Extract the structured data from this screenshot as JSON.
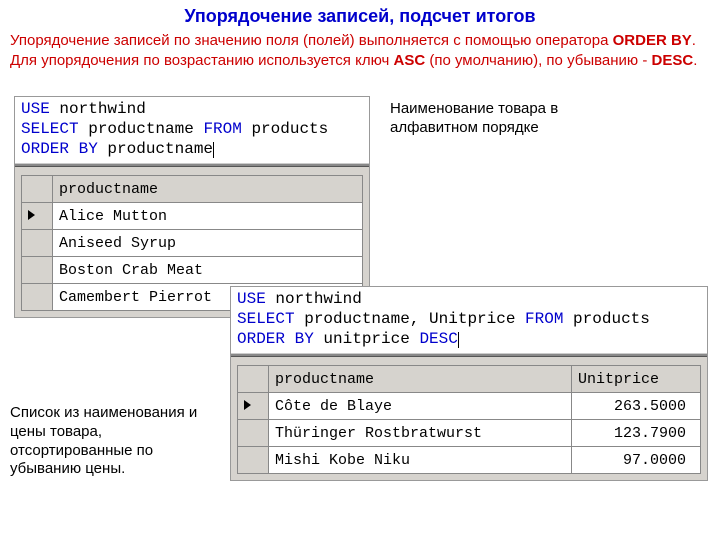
{
  "title": "Упорядочение записей, подсчет итогов",
  "intro_parts": {
    "p1": "Упорядочение записей по значению поля (полей) выполняется с помощью оператора ",
    "b1": "ORDER BY",
    "p2": ". Для упорядочения по возрастанию используется ключ ",
    "b2": "ASC",
    "p3": " (по умолчанию), по убыванию - ",
    "b3": "DESC",
    "p4": "."
  },
  "caption1": "Наименование товара в алфавитном порядке",
  "caption2": "Список из наименования и цены товара, отсортированные по убыванию цены.",
  "query1": {
    "kw_use": "USE",
    "use_val": " northwind",
    "kw_select": "SELECT",
    "sel_val": " productname ",
    "kw_from": "FROM",
    "from_val": " products",
    "kw_order": "ORDER BY",
    "order_val": " productname"
  },
  "query2": {
    "kw_use": "USE",
    "use_val": " northwind",
    "kw_select": "SELECT",
    "sel_val": " productname, Unitprice ",
    "kw_from": "FROM",
    "from_val": " products",
    "kw_order": "ORDER BY",
    "order_val": " unitprice ",
    "kw_desc": "DESC"
  },
  "table1": {
    "header": "productname",
    "rows": [
      "Alice Mutton",
      "Aniseed Syrup",
      "Boston Crab Meat",
      "Camembert Pierrot"
    ]
  },
  "table2": {
    "headers": [
      "productname",
      "Unitprice"
    ],
    "rows": [
      {
        "name": "Côte de Blaye",
        "price": "263.5000"
      },
      {
        "name": "Thüringer Rostbratwurst",
        "price": "123.7900"
      },
      {
        "name": "Mishi Kobe Niku",
        "price": "97.0000"
      }
    ]
  }
}
